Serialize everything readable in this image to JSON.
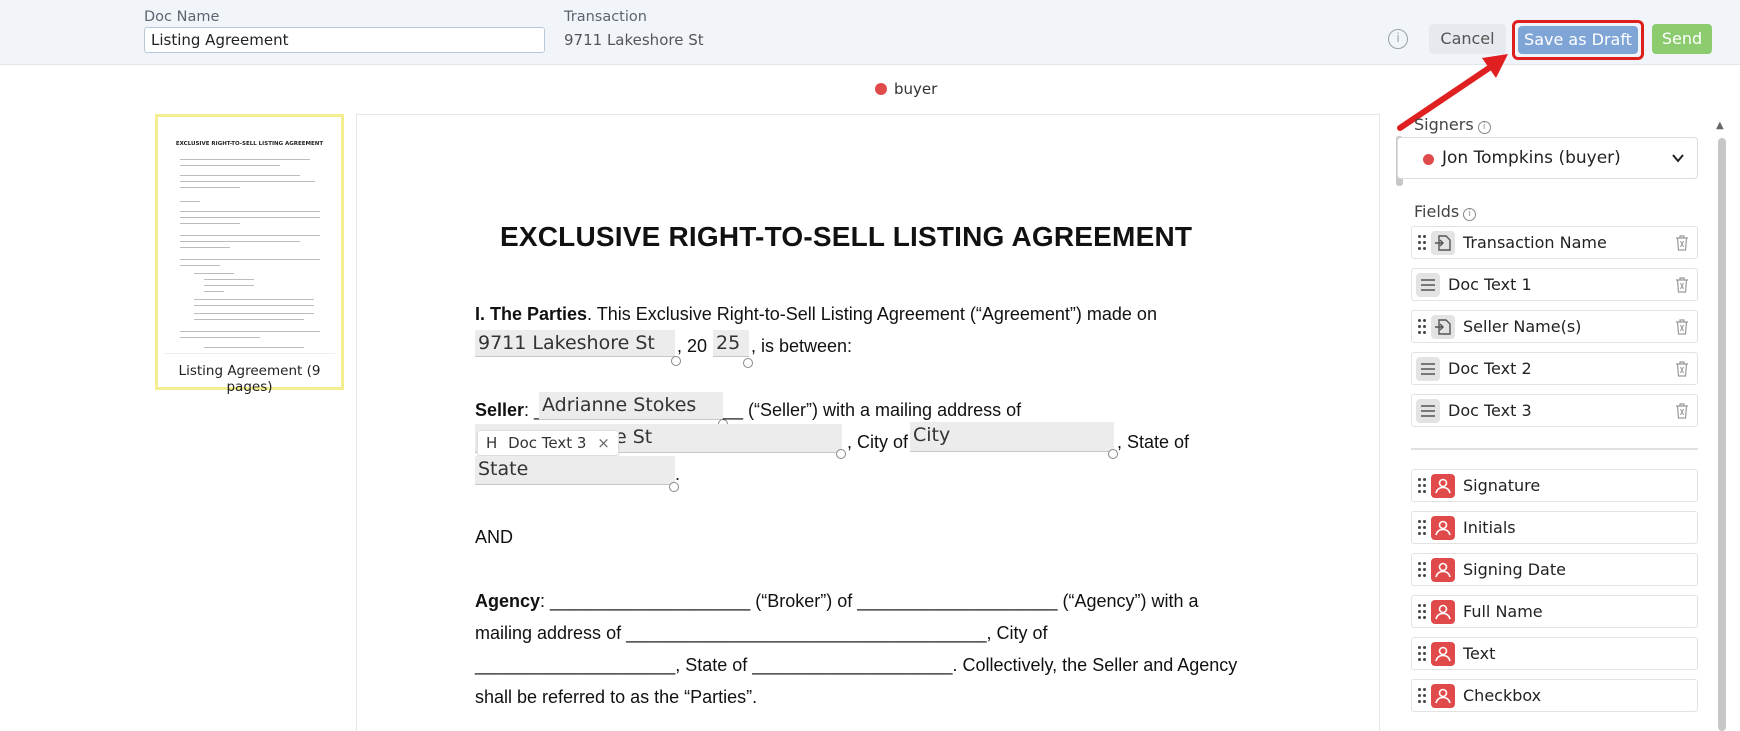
{
  "header": {
    "doc_name_label": "Doc Name",
    "doc_name_value": "Listing Agreement",
    "transaction_label": "Transaction",
    "transaction_value": "9711 Lakeshore St",
    "info_glyph": "i",
    "cancel_label": "Cancel",
    "save_draft_label": "Save as Draft",
    "send_label": "Send"
  },
  "legend": {
    "signer_role": "buyer"
  },
  "thumbnail": {
    "title": "EXCLUSIVE RIGHT-TO-SELL LISTING AGREEMENT",
    "caption": "Listing Agreement (9 pages)"
  },
  "document": {
    "title": "EXCLUSIVE RIGHT-TO-SELL LISTING AGREEMENT",
    "parties_heading": "I. The Parties",
    "parties_text": ". This Exclusive Right-to-Sell Listing Agreement (“Agreement”) made on",
    "date_sep": ", 20",
    "between_text": ", is between:",
    "seller_label": "Seller",
    "seller_colon": ": _",
    "seller_suffix": "__ (“Seller”) with a mailing address of",
    "city_of": ", City of",
    "state_of": ", State of",
    "dot_end": ".",
    "and_text": "AND",
    "agency_line1_label": "Agency",
    "agency_line1_rest": ": ____________________ (“Broker”) of ____________________ (“Agency”) with a",
    "agency_line2": "mailing address of ____________________________________, City of",
    "agency_line3": "____________________, State of ____________________. Collectively, the Seller and Agency",
    "agency_line4": "shall be referred to as the “Parties”.",
    "fields": {
      "transaction_name": "9711 Lakeshore St",
      "year": "25",
      "seller_name": "Adrianne Stokes",
      "address_partial": "e St",
      "city": "City",
      "state": "State"
    },
    "tag_icon": "H",
    "tag_label": "Doc Text 3",
    "tag_close": "×"
  },
  "panel": {
    "signers_label": "Signers",
    "signer_selected": "Jon Tompkins (buyer)",
    "fields_label": "Fields",
    "doc_fields": [
      {
        "name": "Transaction Name",
        "icon": "transaction-icon"
      },
      {
        "name": "Doc Text 1",
        "icon": "text-lines-icon"
      },
      {
        "name": "Seller Name(s)",
        "icon": "transaction-icon"
      },
      {
        "name": "Doc Text 2",
        "icon": "text-lines-icon"
      },
      {
        "name": "Doc Text 3",
        "icon": "text-lines-icon"
      }
    ],
    "signer_fields": [
      {
        "name": "Signature",
        "icon": "user-icon"
      },
      {
        "name": "Initials",
        "icon": "user-icon"
      },
      {
        "name": "Signing Date",
        "icon": "user-icon"
      },
      {
        "name": "Full Name",
        "icon": "user-icon"
      },
      {
        "name": "Text",
        "icon": "user-icon"
      },
      {
        "name": "Checkbox",
        "icon": "user-icon"
      }
    ]
  },
  "colors": {
    "draft_button": "#7fa4d6",
    "send_button": "#8ccc6f",
    "highlight_border": "#dd1f1f",
    "signer_dot": "#e14a4a"
  }
}
